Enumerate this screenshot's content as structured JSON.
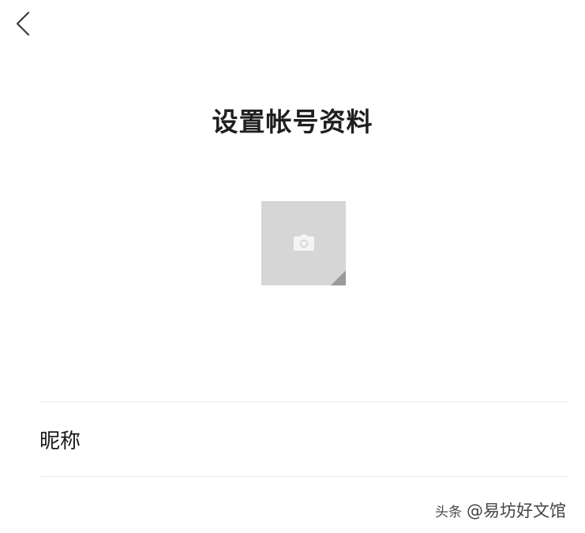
{
  "header": {
    "back_icon": "chevron-left-icon"
  },
  "page": {
    "title": "设置帐号资料"
  },
  "avatar": {
    "icon": "camera-icon",
    "placeholder_color": "#d6d6d6",
    "corner_color": "#9a9a9a"
  },
  "form": {
    "nickname_label": "昵称"
  },
  "watermark": {
    "source": "头条",
    "brand": "@易坊好文馆"
  }
}
